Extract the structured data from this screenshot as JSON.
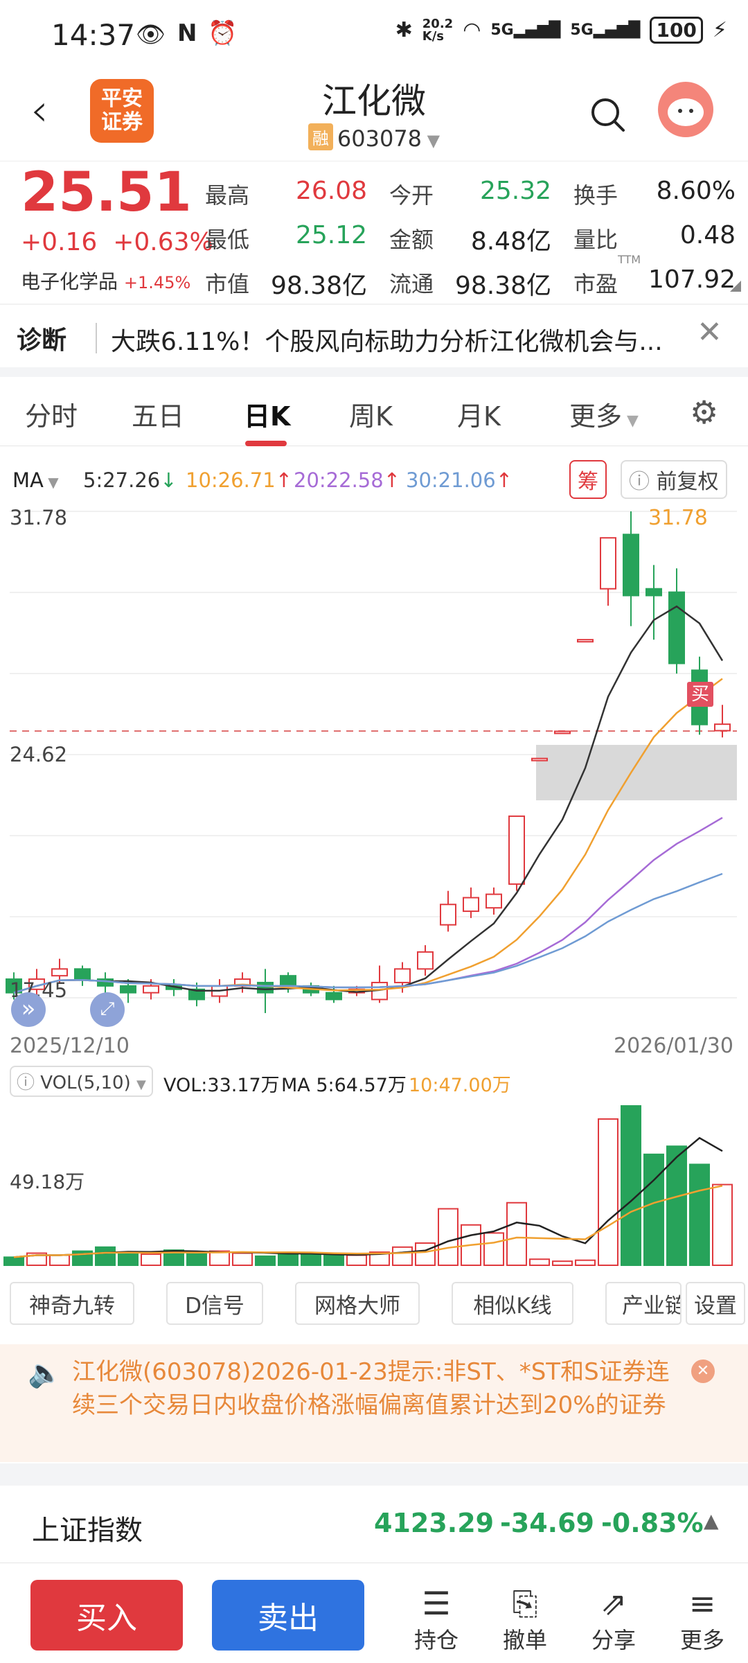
{
  "status_bar": {
    "time": "14:37",
    "net_speed": "20.2\nK/s",
    "battery": "100"
  },
  "header": {
    "back": "‹",
    "broker_logo": "平安\n证券",
    "stock_name": "江化微",
    "rong_badge": "融",
    "stock_code": "603078"
  },
  "quote": {
    "price": "25.51",
    "change": "+0.16",
    "change_pct": "+0.63%",
    "sector": "电子化学品",
    "sector_pct": "+1.45%",
    "fields": [
      {
        "label": "最高",
        "value": "26.08",
        "color": "#e0393e"
      },
      {
        "label": "今开",
        "value": "25.32",
        "color": "#27a35a"
      },
      {
        "label": "换手",
        "value": "8.60%",
        "color": "#222222"
      },
      {
        "label": "最低",
        "value": "25.12",
        "color": "#27a35a"
      },
      {
        "label": "金额",
        "value": "8.48亿",
        "color": "#222222"
      },
      {
        "label": "量比",
        "value": "0.48",
        "color": "#222222"
      },
      {
        "label": "市值",
        "value": "98.38亿",
        "color": "#222222"
      },
      {
        "label": "流通",
        "value": "98.38亿",
        "color": "#222222"
      },
      {
        "label": "市盈",
        "value": "107.92",
        "color": "#222222"
      }
    ],
    "pe_sup": "TTM"
  },
  "diagnosis": {
    "tag": "诊断",
    "text": "大跌6.11%！个股风向标助力分析江化微机会与..."
  },
  "tabs": [
    "分时",
    "五日",
    "日K",
    "周K",
    "月K",
    "更多"
  ],
  "active_tab": "日K",
  "ma": {
    "label": "MA",
    "ma5": "5:27.26",
    "ma10": "10:26.71",
    "ma20": "20:22.58",
    "ma30": "30:21.06",
    "chou": "筹",
    "fuquan": "前复权"
  },
  "chart_labels": {
    "high": "31.78",
    "mid": "24.62",
    "low": "17.45",
    "peak_label": "31.78",
    "date_start": "2025/12/10",
    "date_end": "2026/01/30",
    "buy_mark": "买"
  },
  "vol": {
    "label": "VOL(5,10)",
    "vol": "VOL:33.17万",
    "ma5": "MA 5:64.57万",
    "ma10": "10:47.00万",
    "axis": "49.18万"
  },
  "tools": [
    "神奇九转",
    "D信号",
    "网格大师",
    "相似K线",
    "产业链",
    "设置"
  ],
  "notice": {
    "text": "江化微(603078)2026-01-23提示:非ST、*ST和S证券连续三个交易日内收盘价格涨幅偏离值累计达到20%的证券"
  },
  "index": {
    "name": "上证指数",
    "value": "4123.29",
    "change": "-34.69",
    "pct": "-0.83%"
  },
  "bottom": {
    "buy": "买入",
    "sell": "卖出",
    "nav": [
      {
        "label": "持仓",
        "icon": "☰"
      },
      {
        "label": "撤单",
        "icon": "⎘"
      },
      {
        "label": "分享",
        "icon": "⇗"
      },
      {
        "label": "更多",
        "icon": "≡"
      }
    ]
  },
  "chart_data": {
    "type": "candlestick",
    "y_range": [
      17.45,
      31.78
    ],
    "candles": [
      {
        "o": 18.0,
        "c": 17.6,
        "h": 18.2,
        "l": 17.4
      },
      {
        "o": 17.7,
        "c": 18.0,
        "h": 18.3,
        "l": 17.5
      },
      {
        "o": 18.1,
        "c": 18.3,
        "h": 18.6,
        "l": 17.9
      },
      {
        "o": 18.3,
        "c": 18.0,
        "h": 18.4,
        "l": 17.8
      },
      {
        "o": 18.0,
        "c": 17.8,
        "h": 18.2,
        "l": 17.6
      },
      {
        "o": 17.8,
        "c": 17.6,
        "h": 18.0,
        "l": 17.3
      },
      {
        "o": 17.6,
        "c": 17.8,
        "h": 18.0,
        "l": 17.4
      },
      {
        "o": 17.8,
        "c": 17.7,
        "h": 18.0,
        "l": 17.5
      },
      {
        "o": 17.7,
        "c": 17.4,
        "h": 17.9,
        "l": 17.2
      },
      {
        "o": 17.5,
        "c": 17.8,
        "h": 18.0,
        "l": 17.3
      },
      {
        "o": 17.8,
        "c": 18.0,
        "h": 18.2,
        "l": 17.6
      },
      {
        "o": 17.9,
        "c": 17.6,
        "h": 18.3,
        "l": 17.0
      },
      {
        "o": 18.1,
        "c": 17.8,
        "h": 18.2,
        "l": 17.6
      },
      {
        "o": 17.8,
        "c": 17.6,
        "h": 17.9,
        "l": 17.5
      },
      {
        "o": 17.6,
        "c": 17.4,
        "h": 17.8,
        "l": 17.3
      },
      {
        "o": 17.6,
        "c": 17.7,
        "h": 17.8,
        "l": 17.5
      },
      {
        "o": 17.4,
        "c": 17.9,
        "h": 18.4,
        "l": 17.3
      },
      {
        "o": 17.9,
        "c": 18.3,
        "h": 18.5,
        "l": 17.6
      },
      {
        "o": 18.3,
        "c": 18.8,
        "h": 19.0,
        "l": 18.1
      },
      {
        "o": 19.6,
        "c": 20.2,
        "h": 20.6,
        "l": 19.4
      },
      {
        "o": 20.0,
        "c": 20.4,
        "h": 20.7,
        "l": 19.8
      },
      {
        "o": 20.1,
        "c": 20.5,
        "h": 20.7,
        "l": 19.9
      },
      {
        "o": 20.8,
        "c": 22.8,
        "h": 22.8,
        "l": 20.6
      },
      {
        "o": 24.5,
        "c": 24.5,
        "h": 24.5,
        "l": 24.5
      },
      {
        "o": 25.3,
        "c": 25.3,
        "h": 25.3,
        "l": 25.3
      },
      {
        "o": 28.0,
        "c": 28.0,
        "h": 28.0,
        "l": 28.0
      },
      {
        "o": 29.5,
        "c": 31.0,
        "h": 31.0,
        "l": 29.0
      },
      {
        "o": 31.1,
        "c": 29.3,
        "h": 31.78,
        "l": 28.4
      },
      {
        "o": 29.5,
        "c": 29.3,
        "h": 30.2,
        "l": 28.0
      },
      {
        "o": 29.4,
        "c": 27.3,
        "h": 30.1,
        "l": 27.0
      },
      {
        "o": 27.1,
        "c": 25.5,
        "h": 27.5,
        "l": 25.2
      },
      {
        "o": 25.32,
        "c": 25.51,
        "h": 26.08,
        "l": 25.12
      }
    ],
    "volumes": [
      8,
      12,
      10,
      14,
      18,
      13,
      11,
      15,
      12,
      14,
      12,
      9,
      11,
      12,
      10,
      10,
      13,
      18,
      22,
      56,
      40,
      32,
      62,
      6,
      4,
      5,
      145,
      158,
      110,
      118,
      100,
      80
    ]
  }
}
